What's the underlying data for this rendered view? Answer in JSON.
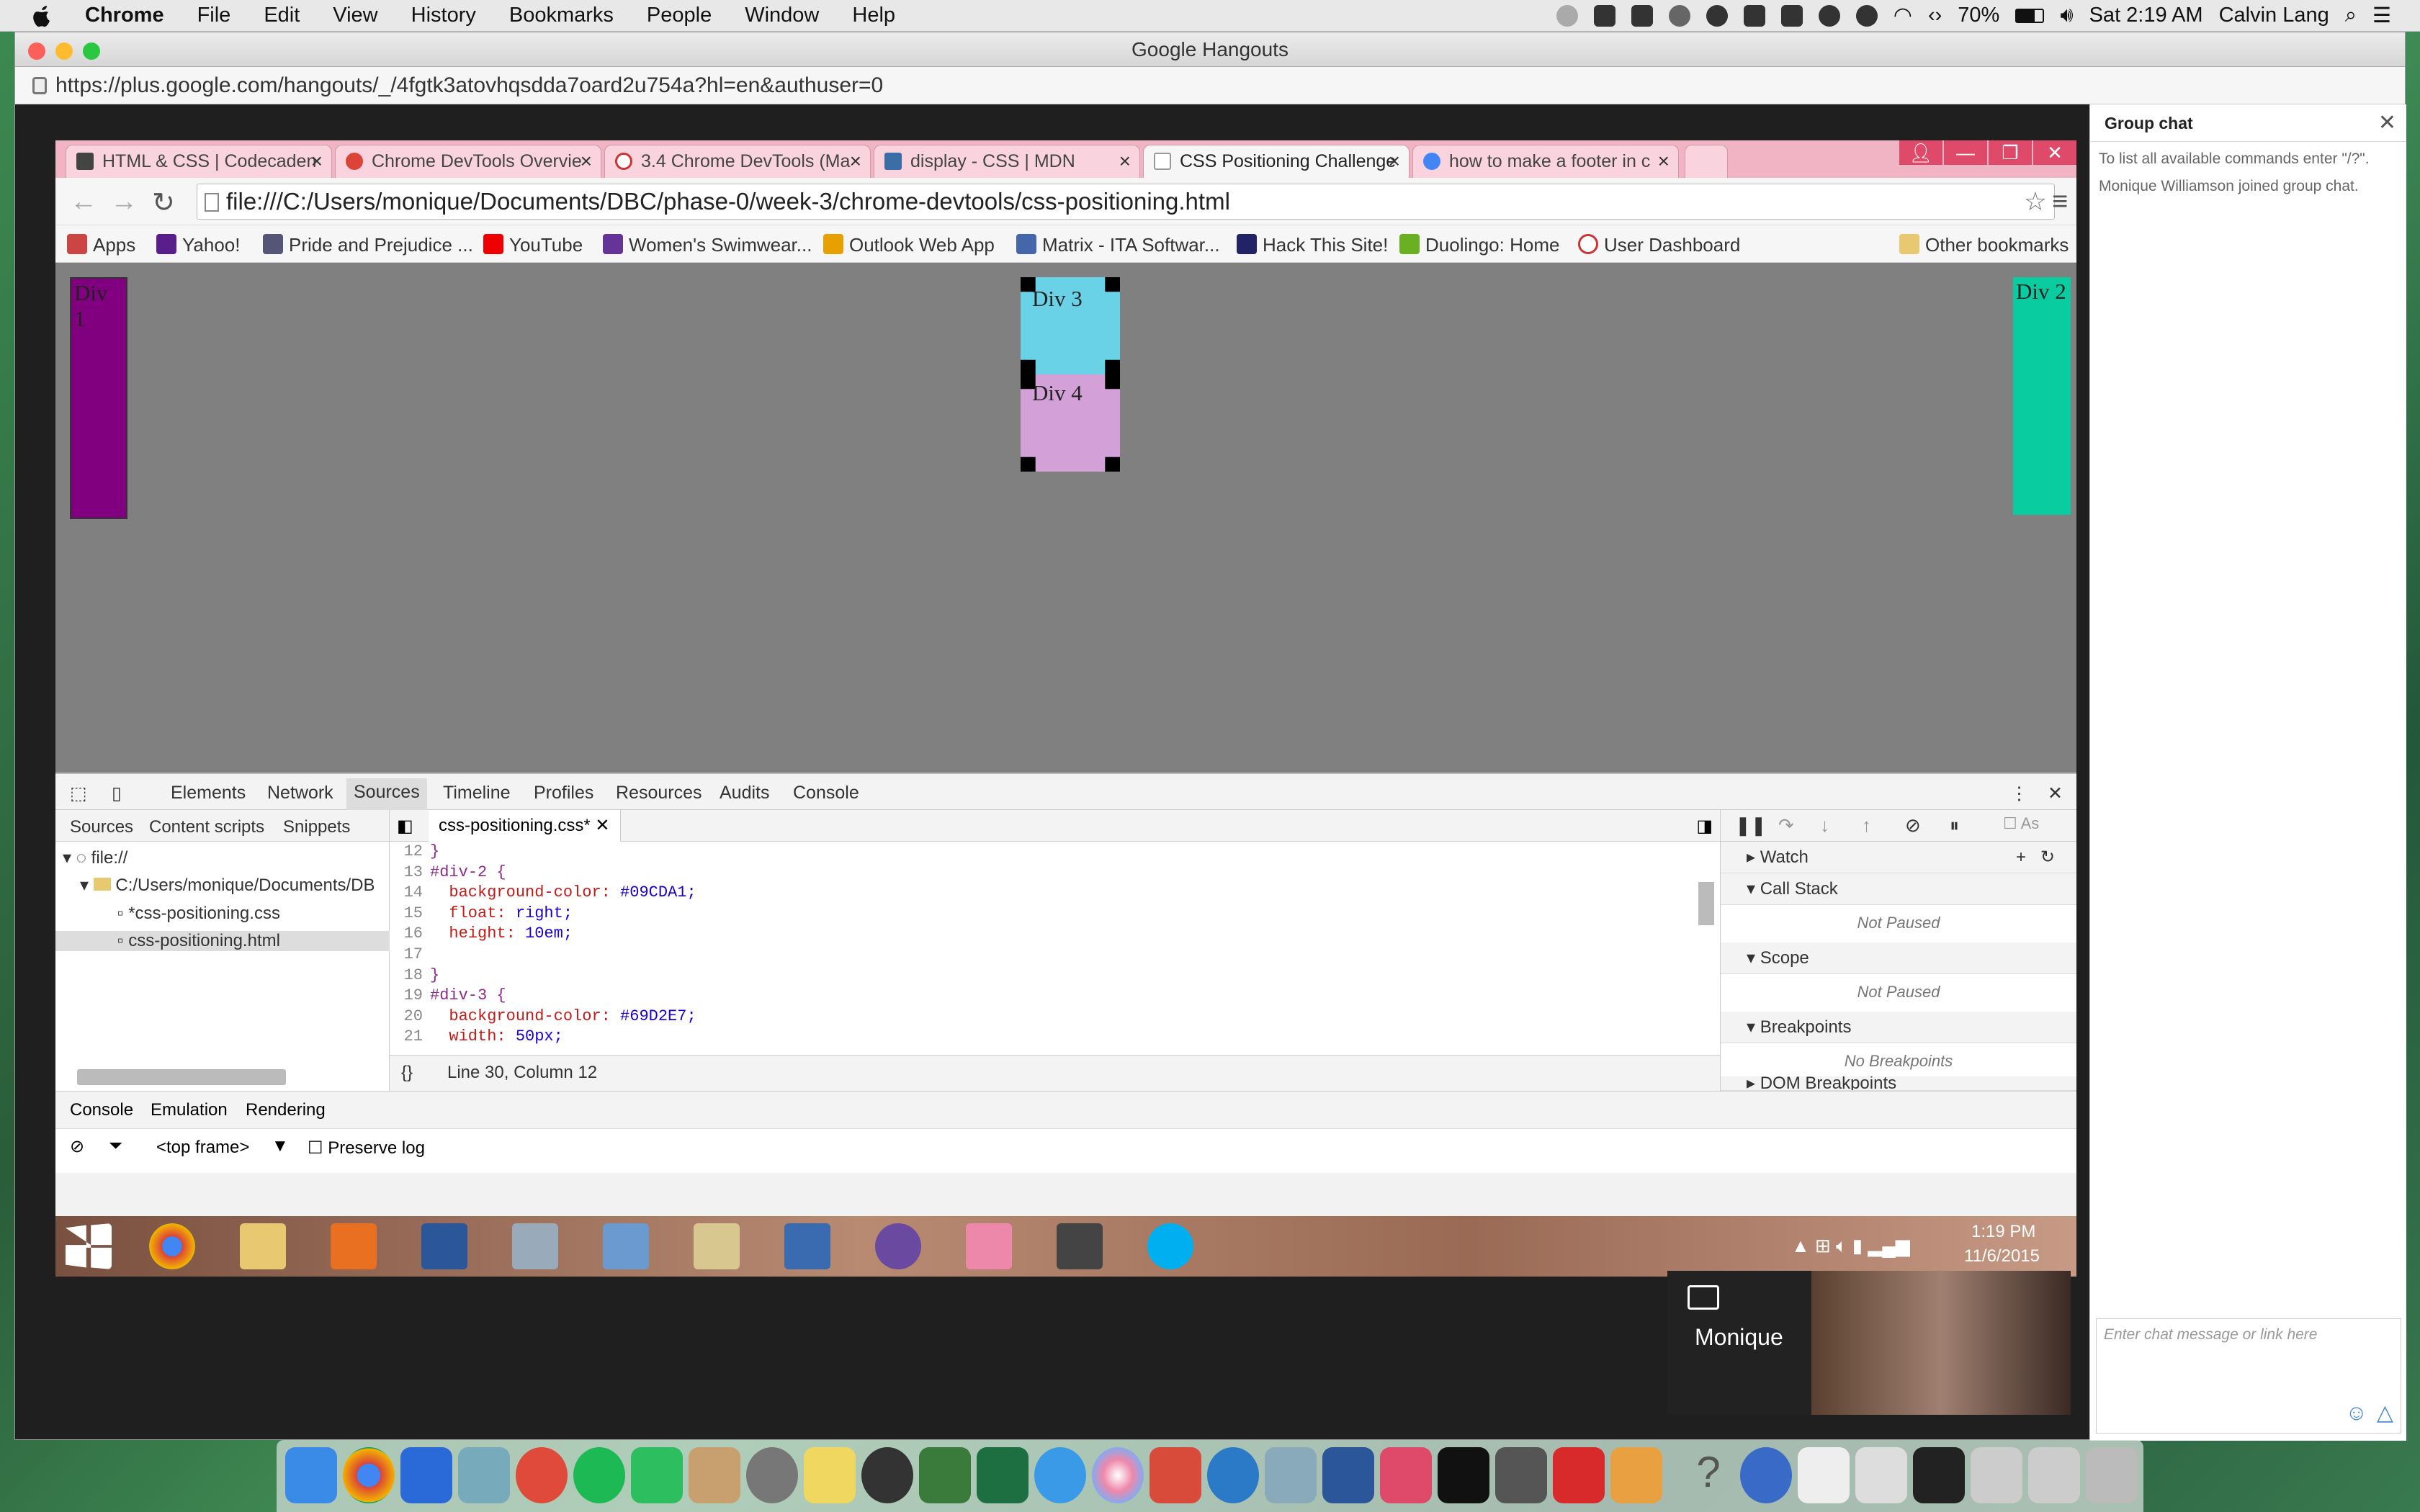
{
  "menubar": {
    "app": "Chrome",
    "items": [
      "File",
      "Edit",
      "View",
      "History",
      "Bookmarks",
      "People",
      "Window",
      "Help"
    ],
    "battery": "70%",
    "clock": "Sat 2:19 AM",
    "user": "Calvin Lang"
  },
  "hangouts": {
    "title": "Google Hangouts",
    "url": "https://plus.google.com/hangouts/_/4fgtk3atovhqsdda7oard2u754a?hl=en&authuser=0",
    "participant": "Monique",
    "chat": {
      "title": "Group chat",
      "messages": [
        "To list all available commands enter \"/?\".",
        "Monique Williamson joined group chat."
      ],
      "placeholder": "Enter chat message or link here"
    }
  },
  "browser": {
    "tabs": [
      {
        "label": "HTML & CSS | Codecaden"
      },
      {
        "label": "Chrome DevTools Overvie"
      },
      {
        "label": "3.4 Chrome DevTools (Ma"
      },
      {
        "label": "display - CSS | MDN"
      },
      {
        "label": "CSS Positioning Challenge",
        "active": true
      },
      {
        "label": "how to make a footer in c"
      }
    ],
    "address": "file:///C:/Users/monique/Documents/DBC/phase-0/week-3/chrome-devtools/css-positioning.html",
    "bookmarks": [
      "Apps",
      "Yahoo!",
      "Pride and Prejudice ...",
      "YouTube",
      "Women's Swimwear...",
      "Outlook Web App",
      "Matrix - ITA Softwar...",
      "Hack This Site!",
      "Duolingo: Home",
      "User Dashboard"
    ],
    "other_bookmarks": "Other bookmarks",
    "page": {
      "div1": "Div 1",
      "div2": "Div 2",
      "div3": "Div 3",
      "div4": "Div 4"
    }
  },
  "devtools": {
    "tabs": [
      "Elements",
      "Network",
      "Sources",
      "Timeline",
      "Profiles",
      "Resources",
      "Audits",
      "Console"
    ],
    "active_tab": "Sources",
    "nav_tabs": [
      "Sources",
      "Content scripts",
      "Snippets"
    ],
    "tree": [
      "file://",
      "C:/Users/monique/Documents/DB",
      "*css-positioning.css",
      "css-positioning.html"
    ],
    "open_file": "css-positioning.css*",
    "code": [
      {
        "n": "12",
        "t": "}"
      },
      {
        "n": "13",
        "t": "#div-2 {"
      },
      {
        "n": "14",
        "p": "background-color:",
        "v": "#09CDA1;"
      },
      {
        "n": "15",
        "p": "float:",
        "v": "right;"
      },
      {
        "n": "16",
        "p": "height:",
        "v": "10em;"
      },
      {
        "n": "17",
        "t": ""
      },
      {
        "n": "18",
        "t": "}"
      },
      {
        "n": "19",
        "t": "#div-3 {"
      },
      {
        "n": "20",
        "p": "background-color:",
        "v": "#69D2E7;"
      },
      {
        "n": "21",
        "p": "width:",
        "v": "50px;"
      }
    ],
    "status": "Line 30, Column 12",
    "debugger": {
      "watch": "Watch",
      "call_stack": "Call Stack",
      "scope": "Scope",
      "breakpoints": "Breakpoints",
      "dom_breakpoints": "DOM Breakpoints",
      "not_paused": "Not Paused",
      "no_breakpoints": "No Breakpoints",
      "as": "As"
    },
    "drawer_tabs": [
      "Console",
      "Emulation",
      "Rendering"
    ],
    "frame": "<top frame>",
    "preserve_log": "Preserve log"
  },
  "taskbar": {
    "time": "1:19 PM",
    "date": "11/6/2015"
  }
}
